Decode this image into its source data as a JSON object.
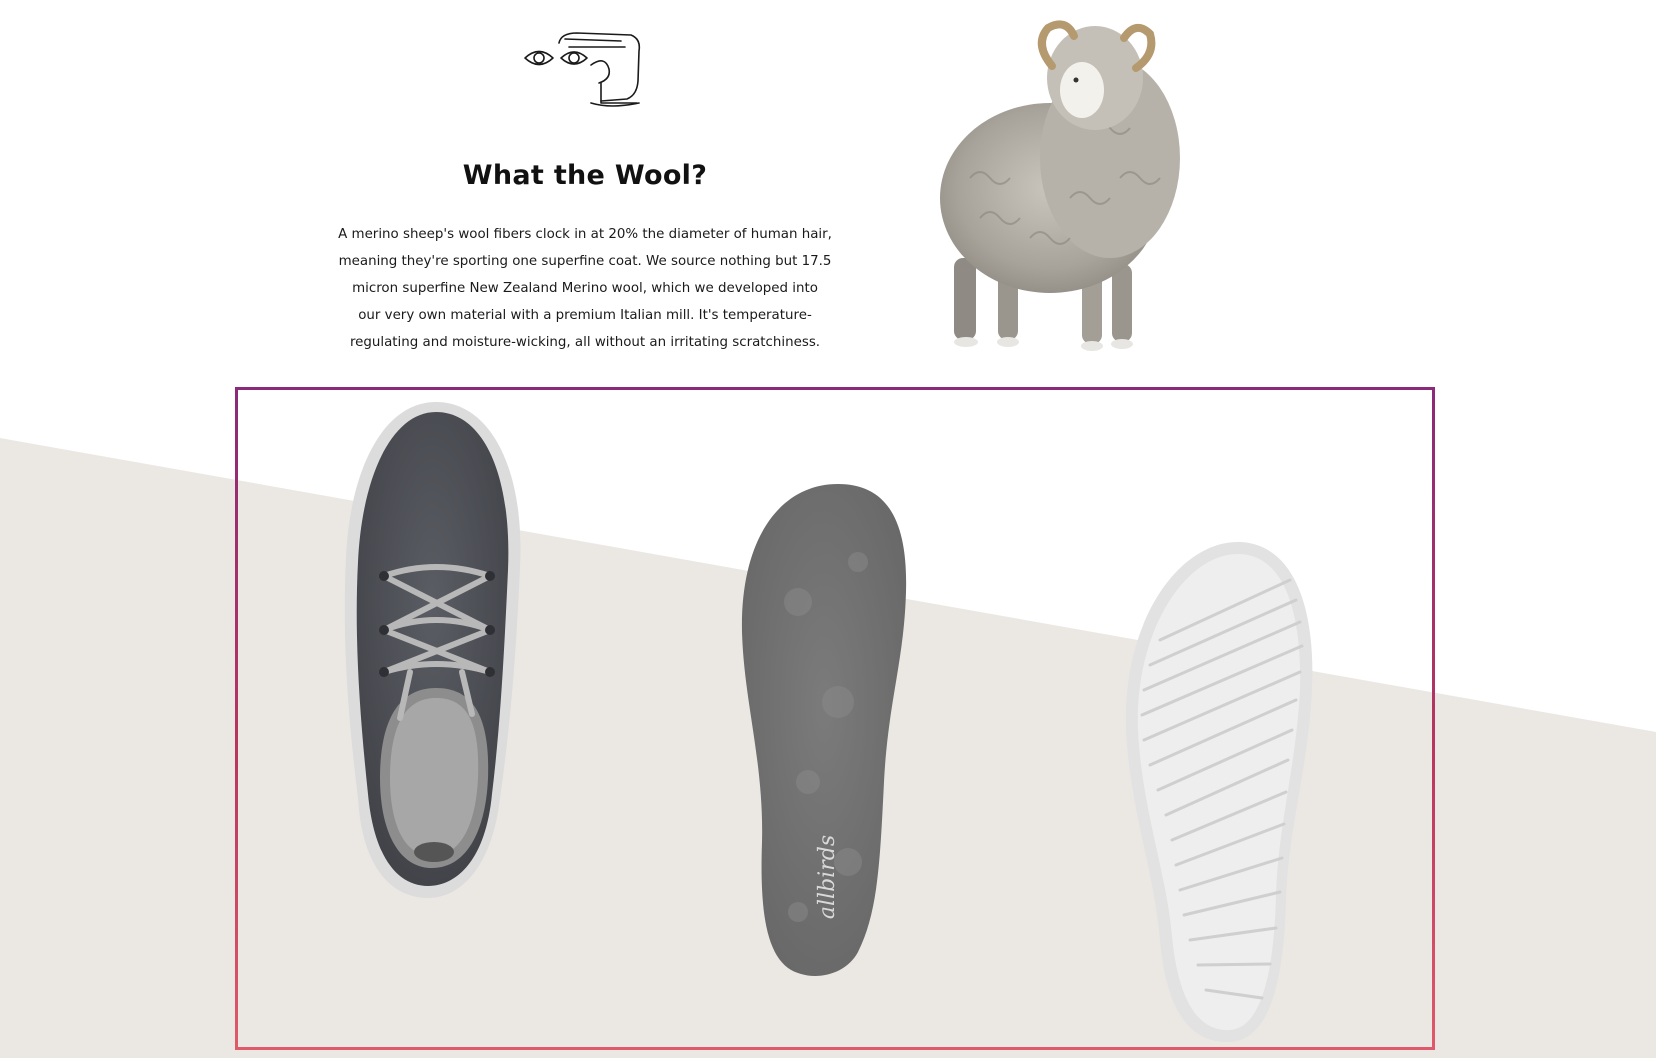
{
  "intro": {
    "icon": "eye-hand-icon",
    "title": "What the Wool?",
    "body_lines": [
      "A merino sheep's wool fibers clock in at 20% the diameter of human hair,",
      "meaning they're sporting one superfine coat. We source nothing but 17.5",
      "micron superfine New Zealand Merino wool, which we developed into",
      "our very own material with a premium Italian mill. It's temperature-",
      "regulating and moisture-wicking, all without an irritating scratchiness."
    ]
  },
  "images": {
    "sheep": "merino-sheep-image",
    "shoe_top": "wool-runner-top-view-image",
    "insole": "wool-insole-image",
    "outsole": "outsole-image"
  },
  "insole_brand": "allbirds",
  "colors": {
    "background": "#ffffff",
    "band": "#ebe8e4",
    "frame_top": "#8a2a78",
    "frame_bottom": "#e0596a",
    "wool_dark": "#4d5056",
    "insole_gray": "#737373",
    "sole_white": "#e8e8e8"
  }
}
